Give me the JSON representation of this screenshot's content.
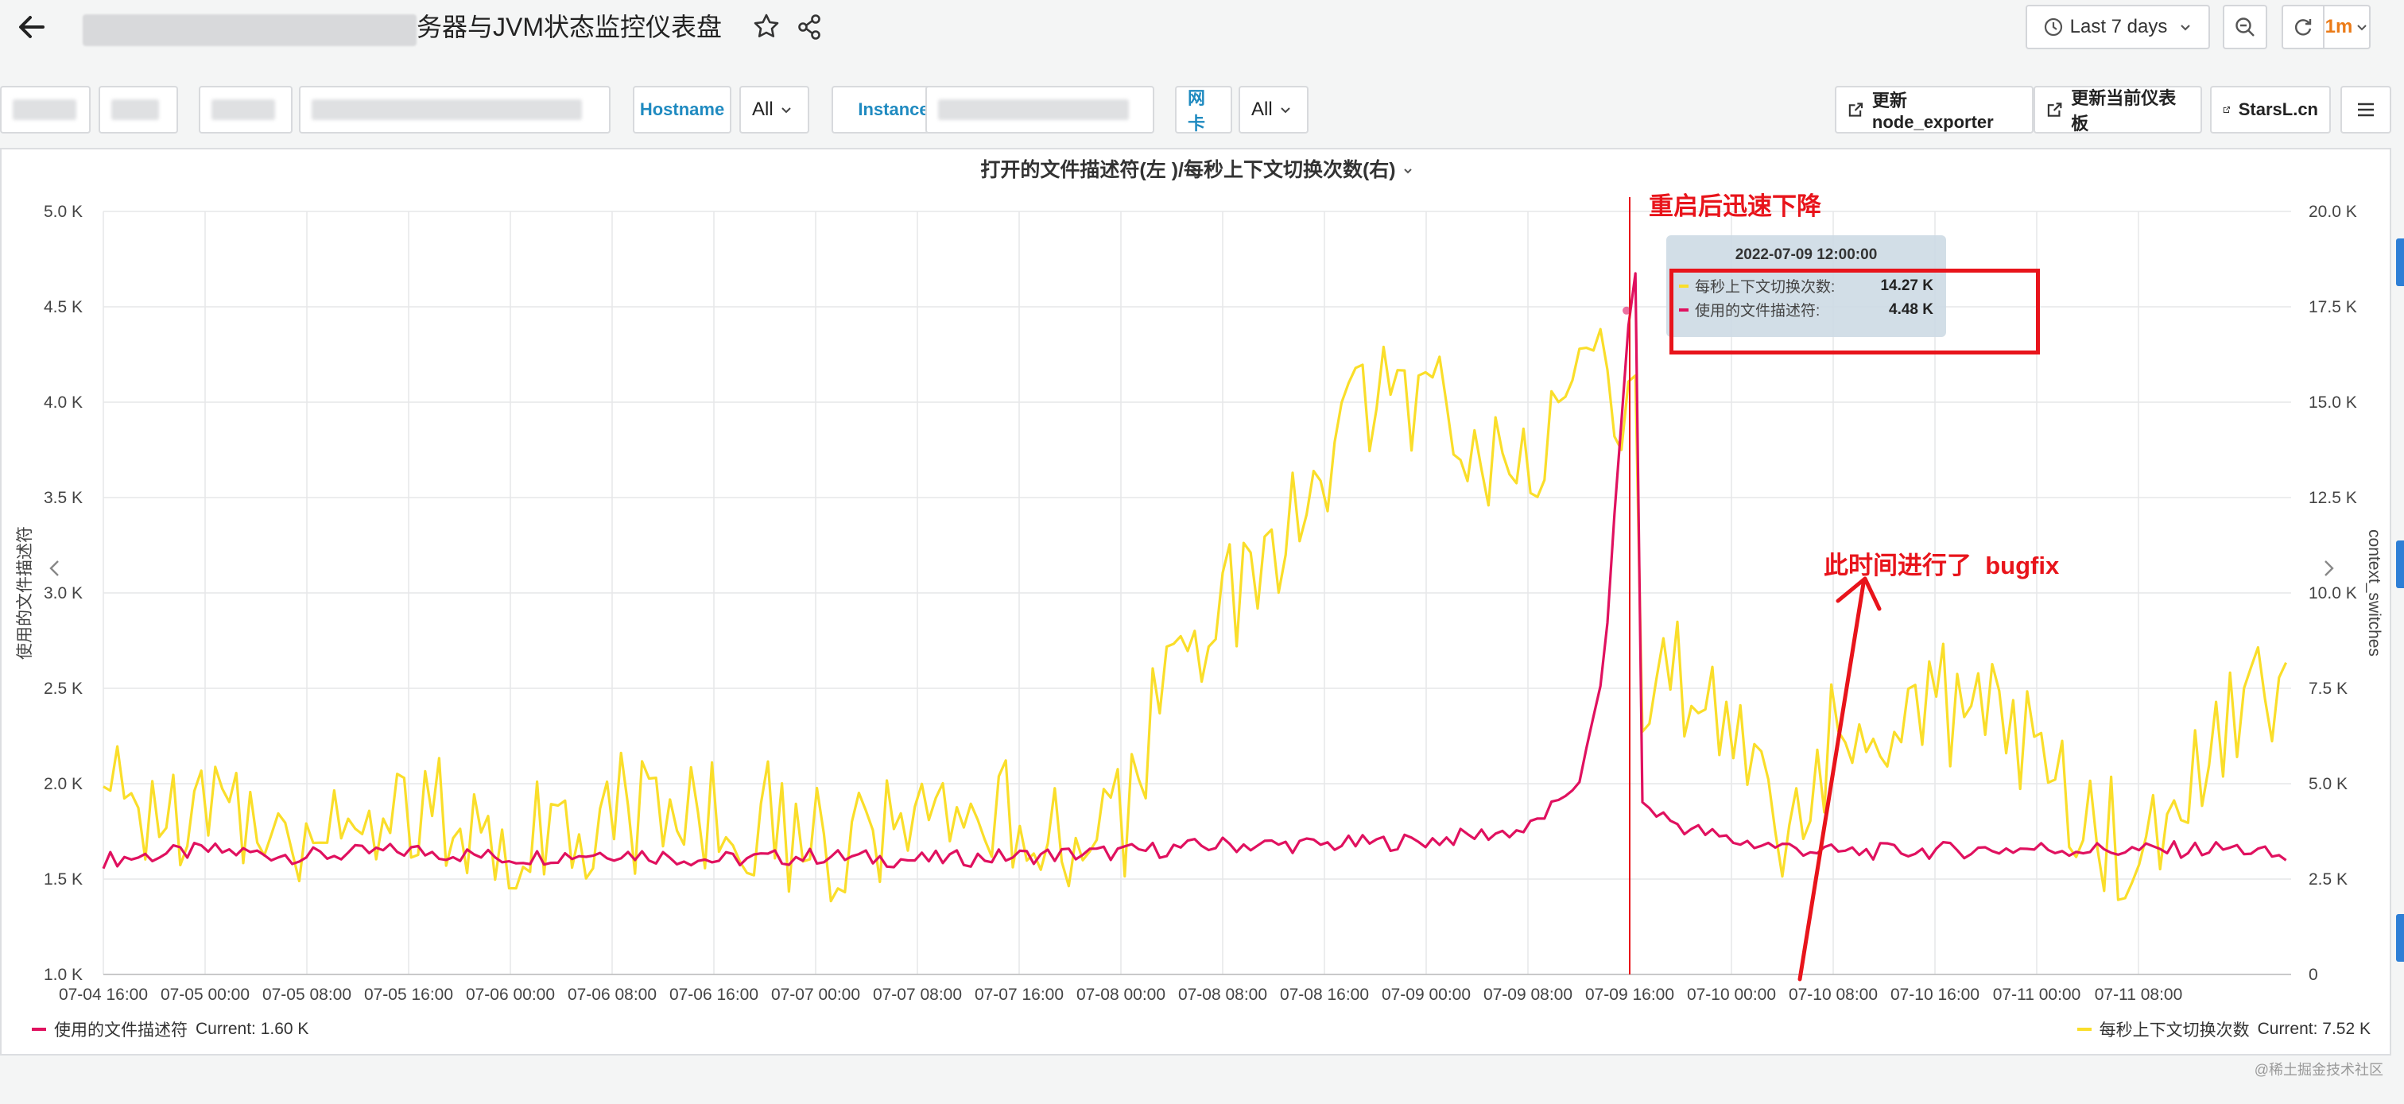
{
  "header": {
    "title": "务器与JVM状态监控仪表盘",
    "time_range": "Last 7 days",
    "refresh_interval": "1m"
  },
  "variables": {
    "hostname_label": "Hostname",
    "hostname_value": "All",
    "instance_label": "Instance",
    "nic_label": "网卡",
    "nic_value": "All"
  },
  "links": {
    "node_exporter": "更新node_exporter",
    "dashboard": "更新当前仪表板",
    "starsl": "StarsL.cn"
  },
  "panel": {
    "title": "打开的文件描述符(左 )/每秒上下文切换次数(右)",
    "y_left_label": "使用的文件描述符",
    "y_right_label": "context_switches",
    "legend_left_name": "使用的文件描述符",
    "legend_left_current": "Current: 1.60 K",
    "legend_right_name": "每秒上下文切换次数",
    "legend_right_current": "Current: 7.52 K"
  },
  "tooltip": {
    "time": "2022-07-09 12:00:00",
    "row1_name": "每秒上下文切换次数:",
    "row1_value": "14.27 K",
    "row2_name": "使用的文件描述符:",
    "row2_value": "4.48 K"
  },
  "annotations": {
    "restart_drop": "重启后迅速下降",
    "bugfix": "此时间进行了  bugfix"
  },
  "watermark": "@稀土掘金技术社区",
  "colors": {
    "fd_series": "#e0115f",
    "ctx_series": "#fade2a",
    "annotation": "#e8141b",
    "variable_label": "#1f8ac0"
  },
  "chart_data": {
    "type": "line",
    "title": "打开的文件描述符(左 )/每秒上下文切换次数(右)",
    "xlabel": "",
    "ylabel": "使用的文件描述符",
    "ylabel_right": "context_switches",
    "x_ticks": [
      "07-04 16:00",
      "07-05 00:00",
      "07-05 08:00",
      "07-05 16:00",
      "07-06 00:00",
      "07-06 08:00",
      "07-06 16:00",
      "07-07 00:00",
      "07-07 08:00",
      "07-07 16:00",
      "07-08 00:00",
      "07-08 08:00",
      "07-08 16:00",
      "07-09 00:00",
      "07-09 08:00",
      "07-09 16:00",
      "07-10 00:00",
      "07-10 08:00",
      "07-10 16:00",
      "07-11 00:00",
      "07-11 08:00"
    ],
    "y_left_ticks": [
      "1.0 K",
      "1.5 K",
      "2.0 K",
      "2.5 K",
      "3.0 K",
      "3.5 K",
      "4.0 K",
      "4.5 K",
      "5.0 K"
    ],
    "y_right_ticks": [
      "0",
      "2.5 K",
      "5.0 K",
      "7.5 K",
      "10.0 K",
      "12.5 K",
      "15.0 K",
      "17.5 K",
      "20.0 K"
    ],
    "ylim_left": [
      1000,
      5000
    ],
    "ylim_right": [
      0,
      20000
    ],
    "x_unit": "hours since 07-04 16:00",
    "series": [
      {
        "name": "使用的文件描述符",
        "axis": "left",
        "x": [
          0,
          8,
          16,
          24,
          32,
          40,
          48,
          56,
          64,
          72,
          80,
          88,
          96,
          104,
          112,
          116,
          118,
          119,
          120,
          120.5,
          121,
          122,
          124,
          128,
          136,
          144,
          152,
          160,
          168,
          172
        ],
        "y": [
          1600,
          1650,
          1620,
          1650,
          1610,
          1640,
          1600,
          1620,
          1600,
          1620,
          1640,
          1680,
          1680,
          1700,
          1760,
          2000,
          2600,
          3600,
          4480,
          4700,
          1900,
          1850,
          1780,
          1700,
          1640,
          1650,
          1660,
          1650,
          1660,
          1600
        ]
      },
      {
        "name": "每秒上下文切换次数",
        "axis": "right",
        "x": [
          0,
          8,
          16,
          24,
          32,
          40,
          48,
          56,
          64,
          72,
          80,
          84,
          88,
          92,
          96,
          100,
          104,
          108,
          112,
          116,
          118,
          119,
          120,
          120.5,
          121,
          124,
          128,
          132,
          136,
          140,
          144,
          148,
          152,
          156,
          160,
          164,
          168,
          172
        ],
        "y": [
          4500,
          4200,
          4000,
          4300,
          3800,
          4200,
          4400,
          3600,
          3400,
          4000,
          3800,
          8000,
          9500,
          10500,
          13500,
          15000,
          15200,
          14000,
          13500,
          16000,
          17000,
          13000,
          16200,
          15800,
          6500,
          7800,
          6800,
          3800,
          6000,
          6900,
          7000,
          7200,
          6000,
          4200,
          3200,
          4500,
          6800,
          7520
        ]
      }
    ],
    "annotations": [
      {
        "x": 120,
        "label": "重启后迅速下降"
      },
      {
        "x": 134,
        "label": "此时间进行了  bugfix"
      }
    ]
  }
}
